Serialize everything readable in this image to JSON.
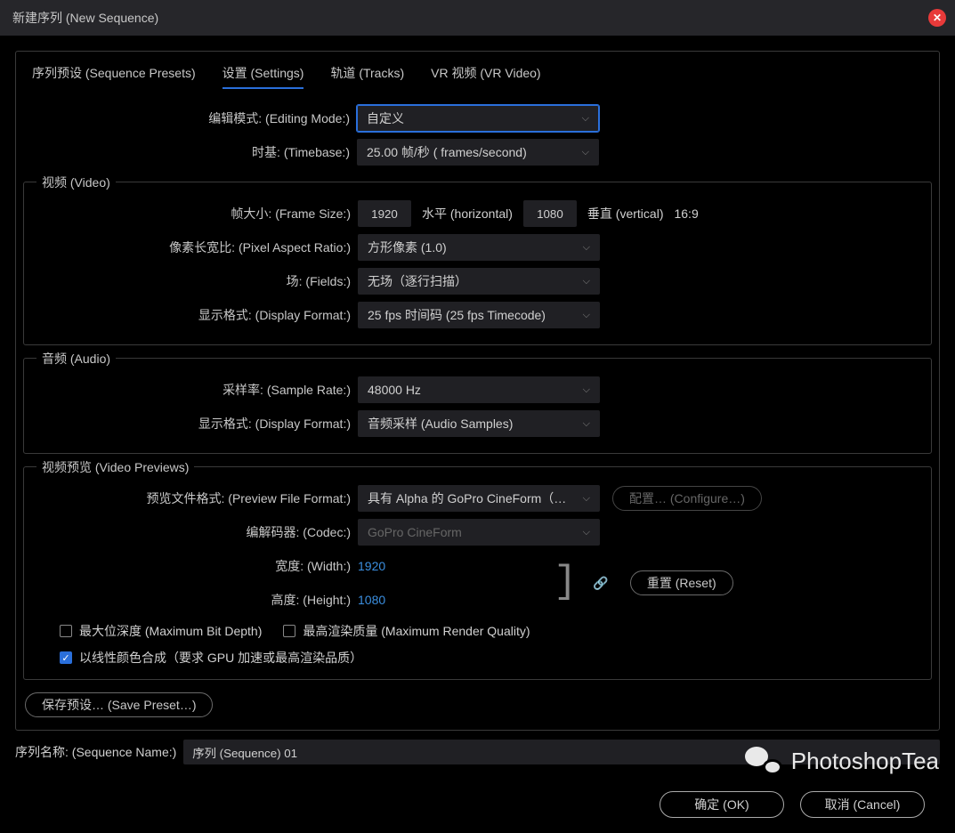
{
  "window": {
    "title": "新建序列 (New Sequence)"
  },
  "tabs": {
    "presets": "序列预设 (Sequence Presets)",
    "settings": "设置 (Settings)",
    "tracks": "轨道 (Tracks)",
    "vr": "VR 视频 (VR Video)"
  },
  "settings": {
    "editing_mode_label": "编辑模式: (Editing Mode:)",
    "editing_mode_value": "自定义",
    "timebase_label": "时基: (Timebase:)",
    "timebase_value": "25.00  帧/秒 ( frames/second)"
  },
  "video": {
    "legend": "视频 (Video)",
    "frame_size_label": "帧大小: (Frame Size:)",
    "width_value": "1920",
    "horizontal_label": "水平 (horizontal)",
    "height_value": "1080",
    "vertical_label": "垂直 (vertical)",
    "aspect": "16:9",
    "par_label": "像素长宽比: (Pixel Aspect Ratio:)",
    "par_value": "方形像素 (1.0)",
    "fields_label": "场: (Fields:)",
    "fields_value": "无场（逐行扫描）",
    "display_format_label": "显示格式: (Display Format:)",
    "display_format_value": "25 fps 时间码 (25 fps Timecode)"
  },
  "audio": {
    "legend": "音频 (Audio)",
    "sample_rate_label": "采样率: (Sample Rate:)",
    "sample_rate_value": "48000 Hz",
    "display_format_label": "显示格式: (Display Format:)",
    "display_format_value": "音频采样 (Audio Samples)"
  },
  "preview": {
    "legend": "视频预览 (Video Previews)",
    "file_format_label": "预览文件格式: (Preview File Format:)",
    "file_format_value": "具有 Alpha 的 GoPro CineForm（…",
    "configure_label": "配置… (Configure…)",
    "codec_label": "编解码器: (Codec:)",
    "codec_value": "GoPro CineForm",
    "width_label": "宽度: (Width:)",
    "width_value": "1920",
    "height_label": "高度: (Height:)",
    "height_value": "1080",
    "reset_label": "重置 (Reset)",
    "max_bit_depth": "最大位深度 (Maximum Bit Depth)",
    "max_render_quality": "最高渲染质量 (Maximum Render Quality)",
    "linear_composite": "以线性颜色合成（要求 GPU 加速或最高渲染品质）"
  },
  "save_preset": "保存预设… (Save Preset…)",
  "sequence_name_label": "序列名称: (Sequence Name:)",
  "sequence_name_value": "序列 (Sequence) 01",
  "ok": "确定 (OK)",
  "cancel": "取消 (Cancel)",
  "watermark": "PhotoshopTea"
}
